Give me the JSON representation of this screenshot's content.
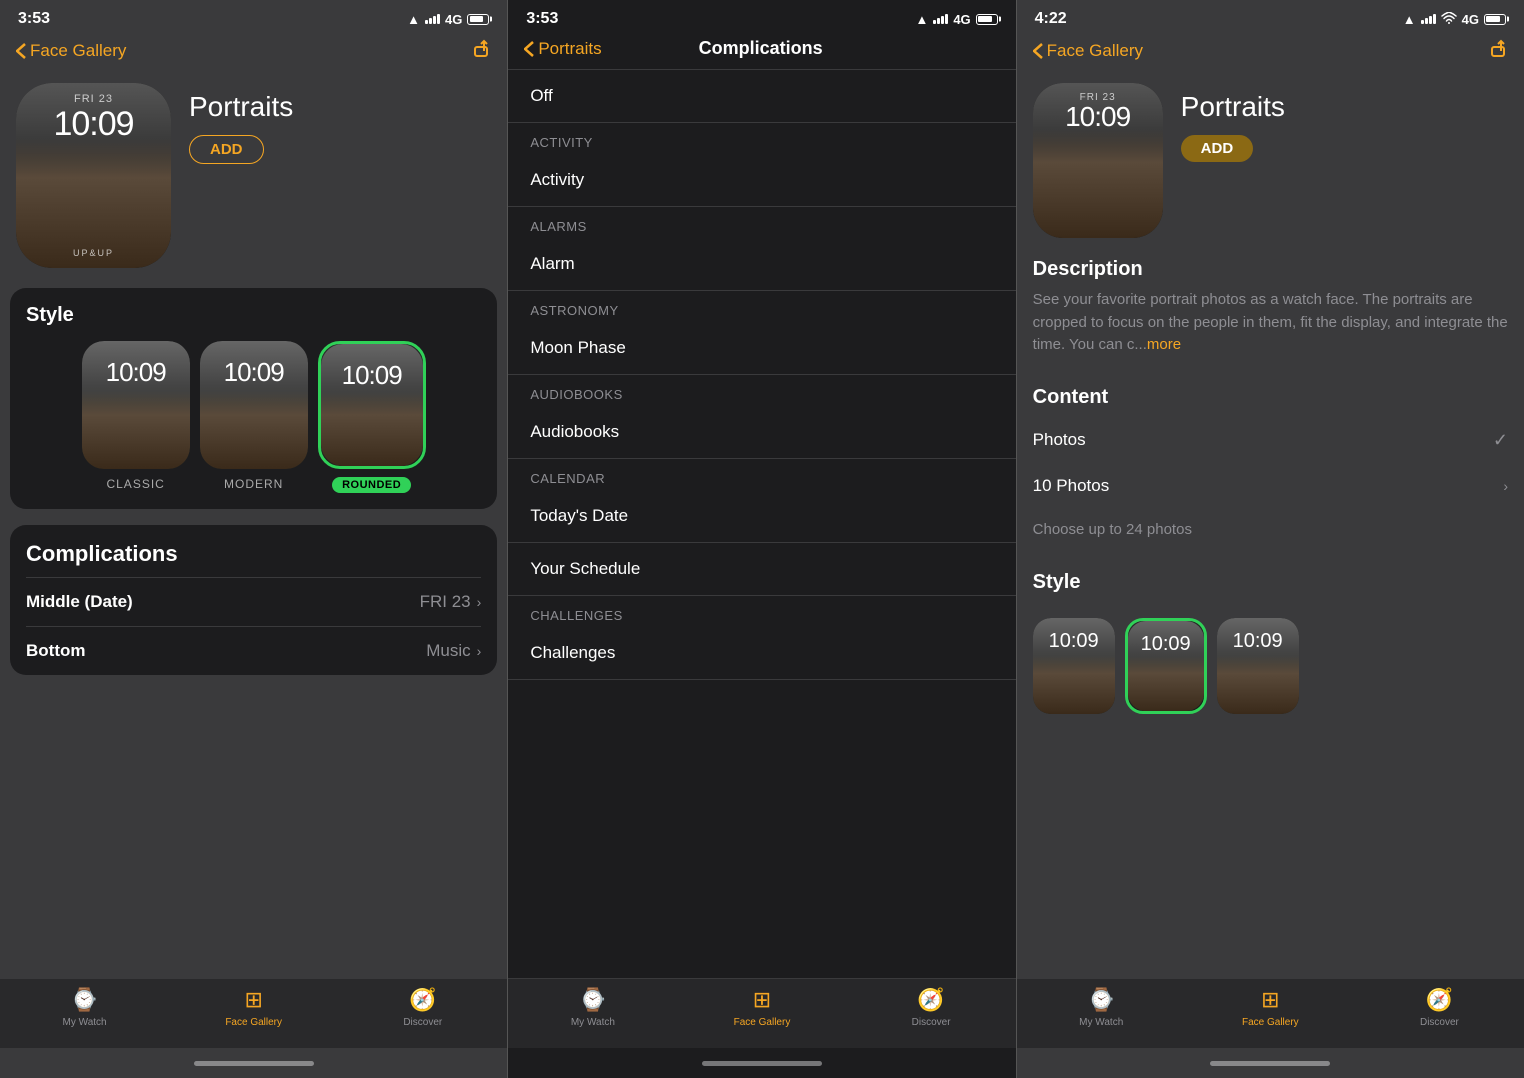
{
  "panels": {
    "left": {
      "statusBar": {
        "time": "3:53",
        "locationIcon": "▲",
        "network": "4G"
      },
      "navBack": "Face Gallery",
      "watchName": "Portraits",
      "addButton": "ADD",
      "watchDate": "FRI 23",
      "watchTime": "10:09",
      "watchLabel": "UP&UP",
      "style": {
        "title": "Style",
        "options": [
          {
            "label": "CLASSIC",
            "type": "classic"
          },
          {
            "label": "MODERN",
            "type": "modern"
          },
          {
            "label": "ROUNDED",
            "type": "rounded",
            "badge": "ROUNDED"
          }
        ]
      },
      "complications": {
        "title": "Complications",
        "rows": [
          {
            "label": "Middle (Date)",
            "value": "FRI 23"
          },
          {
            "label": "Bottom",
            "value": "Music"
          }
        ]
      },
      "tabBar": {
        "items": [
          {
            "label": "My Watch",
            "icon": "⌚",
            "active": false
          },
          {
            "label": "Face Gallery",
            "icon": "🔲",
            "active": true
          },
          {
            "label": "Discover",
            "icon": "🧭",
            "active": false
          }
        ]
      }
    },
    "middle": {
      "statusBar": {
        "time": "3:53",
        "network": "4G"
      },
      "navBack": "Portraits",
      "title": "Complications",
      "items": [
        {
          "type": "item",
          "text": "Off"
        },
        {
          "type": "header",
          "text": "ACTIVITY"
        },
        {
          "type": "item",
          "text": "Activity"
        },
        {
          "type": "header",
          "text": "ALARMS"
        },
        {
          "type": "item",
          "text": "Alarm"
        },
        {
          "type": "header",
          "text": "ASTRONOMY"
        },
        {
          "type": "item",
          "text": "Moon Phase"
        },
        {
          "type": "header",
          "text": "AUDIOBOOKS"
        },
        {
          "type": "item",
          "text": "Audiobooks"
        },
        {
          "type": "header",
          "text": "CALENDAR"
        },
        {
          "type": "item",
          "text": "Today's Date"
        },
        {
          "type": "item",
          "text": "Your Schedule"
        },
        {
          "type": "header",
          "text": "CHALLENGES"
        },
        {
          "type": "item",
          "text": "Challenges"
        }
      ],
      "tabBar": {
        "items": [
          {
            "label": "My Watch",
            "icon": "⌚",
            "active": false
          },
          {
            "label": "Face Gallery",
            "icon": "🔲",
            "active": true
          },
          {
            "label": "Discover",
            "icon": "🧭",
            "active": false
          }
        ]
      }
    },
    "right": {
      "statusBar": {
        "time": "4:22",
        "network": "4G"
      },
      "navBack": "Face Gallery",
      "watchName": "Portraits",
      "addButton": "ADD",
      "watchDate": "FRI 23",
      "watchTime": "10:09",
      "description": {
        "title": "Description",
        "text": "See your favorite portrait photos as a watch face. The portraits are cropped to focus on the people in them, fit the display, and integrate the time. You can c...",
        "moreLabel": "more"
      },
      "content": {
        "title": "Content",
        "rows": [
          {
            "label": "Photos",
            "value": "",
            "hasCheck": true
          },
          {
            "label": "10 Photos",
            "value": "",
            "hasChevron": true
          },
          {
            "label": "Choose up to 24 photos",
            "value": "",
            "isHint": true
          }
        ]
      },
      "style": {
        "title": "Style",
        "options": [
          {
            "type": "classic"
          },
          {
            "type": "rounded"
          },
          {
            "type": "modern"
          }
        ]
      },
      "tabBar": {
        "items": [
          {
            "label": "My Watch",
            "icon": "⌚",
            "active": false
          },
          {
            "label": "Face Gallery",
            "icon": "🔲",
            "active": true
          },
          {
            "label": "Discover",
            "icon": "🧭",
            "active": false
          }
        ]
      }
    }
  }
}
